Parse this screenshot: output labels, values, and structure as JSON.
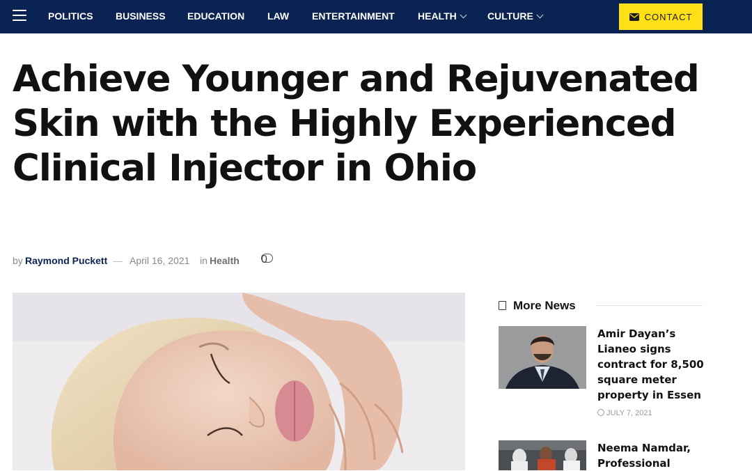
{
  "nav": {
    "menu": [
      {
        "label": "POLITICS",
        "has_dropdown": false
      },
      {
        "label": "BUSINESS",
        "has_dropdown": false
      },
      {
        "label": "EDUCATION",
        "has_dropdown": false
      },
      {
        "label": "LAW",
        "has_dropdown": false
      },
      {
        "label": "ENTERTAINMENT",
        "has_dropdown": false
      },
      {
        "label": "HEALTH",
        "has_dropdown": true
      },
      {
        "label": "CULTURE",
        "has_dropdown": true
      }
    ],
    "contact_label": "CONTACT",
    "colors": {
      "bar": "#0b2353",
      "contact_bg": "#ffe016"
    }
  },
  "article": {
    "title": "Achieve Younger and Rejuvenated Skin with the Highly Experienced Clinical Injector in Ohio",
    "by": "by",
    "author": "Raymond Puckett",
    "separator": "—",
    "date": "April 16, 2021",
    "in": "in",
    "category": "Health",
    "comment_count": "0",
    "featured_image": "woman-face-massage-photo"
  },
  "sidebar": {
    "heading": "More News",
    "heading_icon": "document-icon",
    "items": [
      {
        "title": "Amir Dayan’s Lianeo signs contract for 8,500 square meter property in Essen",
        "date": "JULY 7, 2021",
        "thumbnail": "man-in-suit-portrait"
      },
      {
        "title": "Neema Namdar, Professional",
        "thumbnail": "basketball-players-photo"
      }
    ]
  }
}
